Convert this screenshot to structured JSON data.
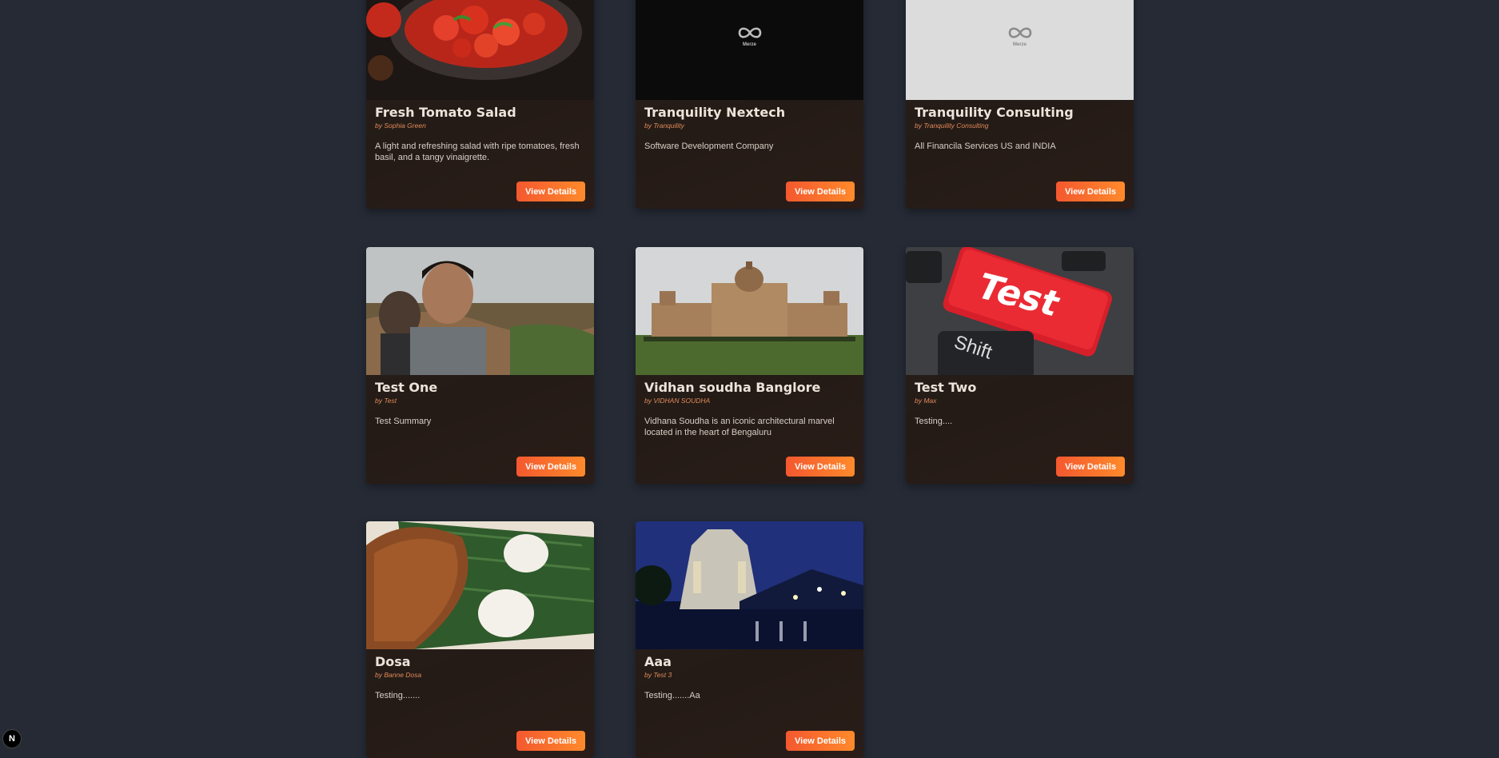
{
  "cards": [
    {
      "title": "Fresh Tomato Salad",
      "author": "by Sophia Green",
      "summary": "A light and refreshing salad with ripe tomatoes, fresh basil, and a tangy vinaigrette.",
      "button": "View Details",
      "image": "tomato-salad-photo"
    },
    {
      "title": "Tranquility Nextech",
      "author": "by Tranquility",
      "summary": "Software Development Company",
      "button": "View Details",
      "image": "merze-logo-dark",
      "logo_text": "Merze"
    },
    {
      "title": "Tranquility Consulting",
      "author": "by Tranquility Consulting",
      "summary": "All Financila Services US and INDIA",
      "button": "View Details",
      "image": "merze-logo-light",
      "logo_text": "Merze"
    },
    {
      "title": "Test One",
      "author": "by Test",
      "summary": "Test Summary",
      "button": "View Details",
      "image": "selfie-photo"
    },
    {
      "title": "Vidhan soudha Banglore",
      "author": "by VIDHAN SOUDHA",
      "summary": "Vidhana Soudha is an iconic architectural marvel located in the heart of Bengaluru",
      "button": "View Details",
      "image": "vidhana-soudha-photo"
    },
    {
      "title": "Test Two",
      "author": "by Max",
      "summary": "Testing....",
      "button": "View Details",
      "image": "test-key-photo",
      "key_text": "Test",
      "shift_text": "Shift"
    },
    {
      "title": "Dosa",
      "author": "by Banne Dosa",
      "summary": "Testing.......",
      "button": "View Details",
      "image": "dosa-photo"
    },
    {
      "title": "Aaa",
      "author": "by Test 3",
      "summary": "Testing.......Aa",
      "button": "View Details",
      "image": "temple-night-photo"
    }
  ],
  "badge": {
    "label": "N",
    "icon": "nextjs-icon"
  },
  "colors": {
    "background": "#252a35",
    "button_start": "#f4582f",
    "button_end": "#ff8a2b",
    "author": "#e08a5a"
  }
}
